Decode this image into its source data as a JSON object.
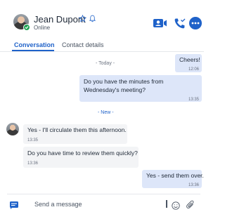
{
  "contact": {
    "name": "Jean Dupont",
    "status": "Online",
    "presence_color": "#22a355"
  },
  "header": {
    "icons": [
      "star-icon",
      "bell-icon",
      "video-call-icon",
      "phone-call-icon",
      "more-options-icon"
    ],
    "accent": "#1f62c9"
  },
  "tabs": [
    {
      "label": "Conversation",
      "active": true
    },
    {
      "label": "Contact details",
      "active": false
    }
  ],
  "dividers": {
    "today": "- Today -",
    "new": "- New -"
  },
  "messages": [
    {
      "direction": "outgoing",
      "text": "Cheers!",
      "time": "12:06"
    },
    {
      "direction": "outgoing",
      "text": "Do you have the minutes from Wednesday's meeting?",
      "time": "13:35"
    },
    {
      "direction": "incoming",
      "text": "Yes - I'll circulate them this afternoon.",
      "time": "13:35"
    },
    {
      "direction": "incoming",
      "text": "Do you have time to review them quickly?",
      "time": "13:36"
    },
    {
      "direction": "outgoing",
      "text": "Yes - send them over.",
      "time": "13:36"
    }
  ],
  "composer": {
    "placeholder": "Send a message",
    "icons": [
      "chat-icon",
      "emoji-icon",
      "attachment-icon"
    ]
  }
}
